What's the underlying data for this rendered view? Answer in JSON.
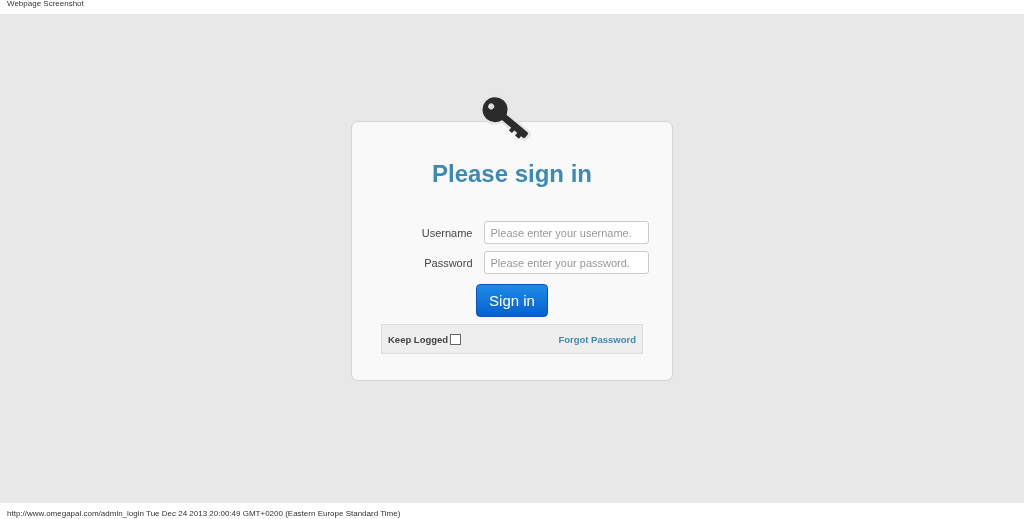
{
  "header": {
    "title": "Webpage Screenshot"
  },
  "login": {
    "title": "Please sign in",
    "fields": [
      {
        "label": "Username",
        "placeholder": "Please enter your username."
      },
      {
        "label": "Password",
        "placeholder": "Please enter your password."
      }
    ],
    "button": "Sign in",
    "keep_logged": {
      "label": "Keep Logged",
      "checked": false
    },
    "forgot_link": "Forgot Password"
  },
  "footer": {
    "text": "http://www.omegapal.com/admin_login Tue Dec 24 2013 20:00:49 GMT+0200 (Eastern Europe Standard Time)"
  }
}
